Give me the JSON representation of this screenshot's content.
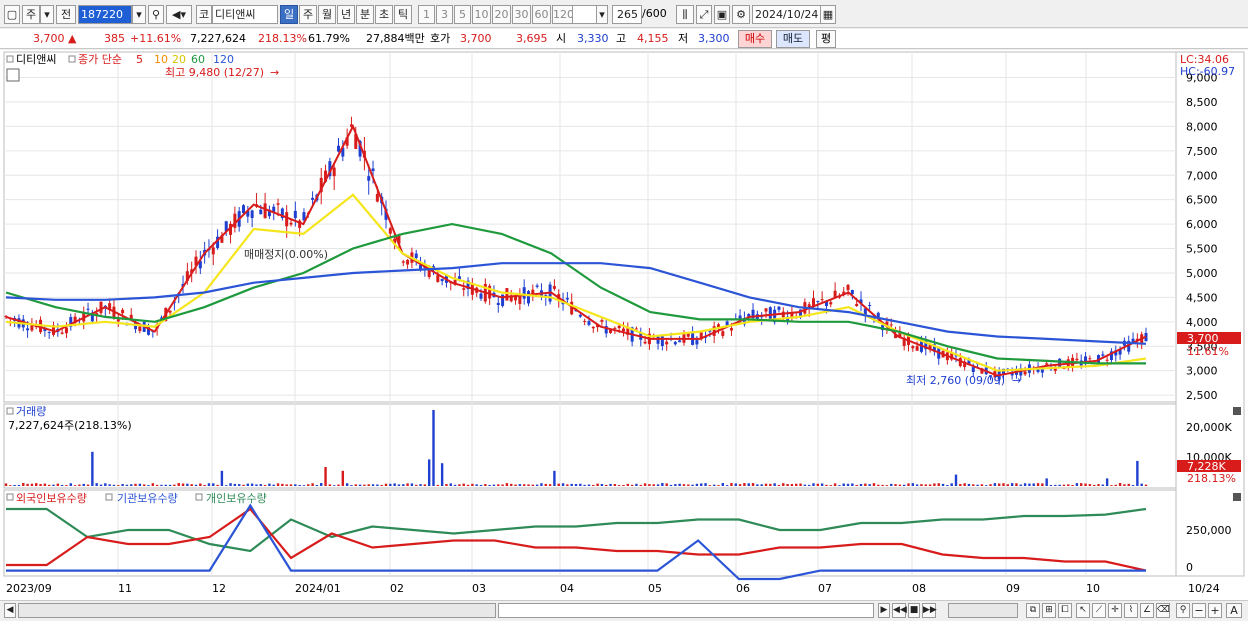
{
  "toolbar": {
    "market": "주",
    "prev_label": "전",
    "stock_code": "187220",
    "stock_name": "디티앤씨",
    "periods": [
      "일",
      "주",
      "월",
      "년",
      "분",
      "초",
      "틱"
    ],
    "selected_period": "일",
    "minute_options": [
      "1",
      "3",
      "5",
      "10",
      "20",
      "30",
      "60",
      "120"
    ],
    "count_display": "265",
    "count_total": "/600",
    "date_value": "2024/10/24",
    "code_prefix": "코"
  },
  "price_info": {
    "price": "3,700",
    "arrow": "▲",
    "change": "385",
    "change_pct": "+11.61%",
    "volume": "7,227,624",
    "volume_ratio": "218.13%",
    "turnover": "61.79%",
    "amount": "27,884백만",
    "hoga_label": "호가",
    "ask": "3,700",
    "bid": "3,695",
    "open_label": "시",
    "open": "3,330",
    "high_label": "고",
    "high": "4,155",
    "low_label": "저",
    "low": "3,300",
    "buy_label": "매수",
    "sell_label": "매도",
    "eval_label": "평"
  },
  "price_panel": {
    "stock_label": "디티앤씨",
    "ma_label": "종가 단순",
    "ma_periods": [
      {
        "label": "5",
        "color": "#d81b1b"
      },
      {
        "label": "10",
        "color": "#f08c00"
      },
      {
        "label": "20",
        "color": "#f5e51b"
      },
      {
        "label": "60",
        "color": "#1e9a3c"
      },
      {
        "label": "120",
        "color": "#2b55d6"
      }
    ],
    "max_annotation": "최고 9,480 (12/27)",
    "min_annotation": "최저 2,760 (09/09)",
    "trade_halt_note": "매매정지(0.00%)",
    "lc": "LC:34.06",
    "hc": "HC:-60.97",
    "current_price_tag": "3,700",
    "current_pct_tag": "11.61%",
    "y_ticks": [
      "9,000",
      "8,500",
      "8,000",
      "7,500",
      "7,000",
      "6,500",
      "6,000",
      "5,500",
      "5,000",
      "4,500",
      "4,000",
      "3,500",
      "3,000",
      "2,500"
    ]
  },
  "volume_panel": {
    "title": "거래량",
    "value_label": "7,227,624주(218.13%)",
    "y_ticks": [
      "20,000K",
      "10,000K"
    ],
    "current_tag": "7,228K",
    "current_pct": "218.13%"
  },
  "holding_panel": {
    "series": [
      {
        "label": "외국인보유수량",
        "color": "#d81b1b"
      },
      {
        "label": "기관보유수량",
        "color": "#2b55d6"
      },
      {
        "label": "개인보유수량",
        "color": "#2e8b57"
      }
    ],
    "y_ticks": [
      "250,000",
      "0"
    ]
  },
  "x_axis": {
    "labels": [
      "2023/09",
      "11",
      "12",
      "2024/01",
      "02",
      "03",
      "04",
      "05",
      "06",
      "07",
      "08",
      "09",
      "10",
      "10/24"
    ]
  },
  "colors": {
    "up": "#d81b1b",
    "down": "#1f3fd0",
    "ma5": "#d81b1b",
    "ma10": "#f08c00",
    "ma20": "#f5e51b",
    "ma60": "#1e9a3c",
    "ma120": "#2b55d6"
  },
  "chart_data": {
    "type": "line",
    "ylim": [
      2400,
      9400
    ],
    "x": [
      "2023/09",
      "11",
      "12",
      "2024/01",
      "02",
      "03",
      "04",
      "05",
      "06",
      "07",
      "08",
      "09",
      "10",
      "10/24"
    ],
    "series": [
      {
        "name": "5",
        "values": [
          4100,
          3800,
          4300,
          3800,
          5400,
          6400,
          6000,
          8000,
          5400,
          4800,
          4500,
          4600,
          3900,
          3650,
          3650,
          4100,
          4200,
          4600,
          3700,
          3300,
          2900,
          3100,
          3200,
          3700
        ]
      },
      {
        "name": "20",
        "values": [
          4000,
          3900,
          4000,
          3900,
          4600,
          5900,
          5800,
          6600,
          5400,
          4900,
          4600,
          4500,
          4100,
          3700,
          3800,
          4000,
          4100,
          4300,
          3800,
          3400,
          3000,
          3050,
          3100,
          3250
        ]
      },
      {
        "name": "60",
        "values": [
          4600,
          4300,
          4100,
          4000,
          4300,
          4700,
          5000,
          5500,
          5800,
          6000,
          5800,
          5400,
          4700,
          4200,
          4050,
          4050,
          4000,
          4000,
          3800,
          3500,
          3250,
          3200,
          3150,
          3150
        ]
      },
      {
        "name": "120",
        "values": [
          4500,
          4450,
          4450,
          4500,
          4600,
          4800,
          4900,
          5000,
          5050,
          5100,
          5200,
          5200,
          5200,
          5100,
          4800,
          4500,
          4300,
          4200,
          4000,
          3800,
          3700,
          3650,
          3600,
          3550
        ]
      }
    ]
  }
}
